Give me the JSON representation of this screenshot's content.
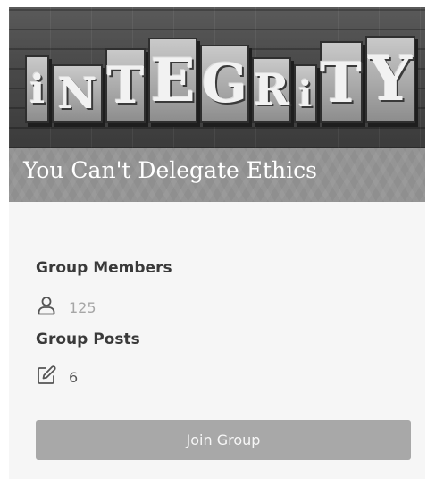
{
  "hero": {
    "image_icon": "integrity-letterpress-image",
    "letters": [
      "i",
      "N",
      "T",
      "E",
      "G",
      "R",
      "i",
      "T",
      "Y"
    ]
  },
  "group": {
    "title": "You Can't Delegate Ethics"
  },
  "stats": {
    "members_label": "Group Members",
    "members_icon": "user-icon",
    "members_count": "125",
    "posts_label": "Group Posts",
    "posts_icon": "edit-icon",
    "posts_count": "6"
  },
  "actions": {
    "join_label": "Join Group"
  },
  "colors": {
    "title_band": "#8f8f8f",
    "card_background": "#f6f6f6",
    "join_button": "#a8a8a8"
  }
}
